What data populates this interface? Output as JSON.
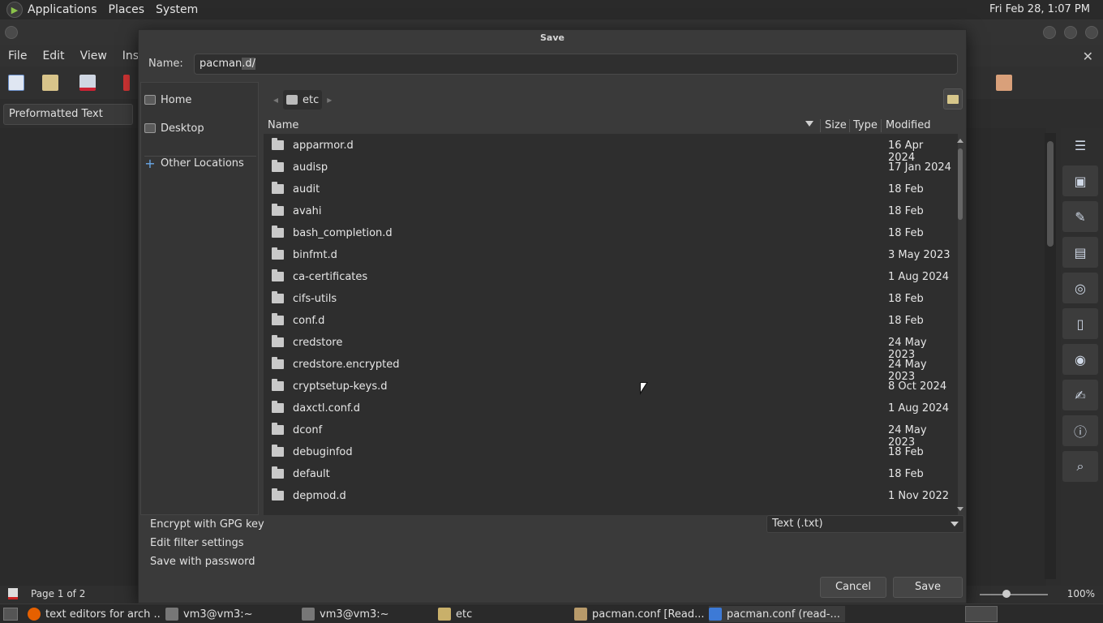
{
  "top_panel": {
    "menus": [
      "Applications",
      "Places",
      "System"
    ],
    "clock": "Fri Feb 28,  1:07 PM"
  },
  "background_app": {
    "menubar": [
      "File",
      "Edit",
      "View",
      "Inse"
    ],
    "paragraph_style": "Preformatted Text",
    "status_page": "Page 1 of 2",
    "zoom_level": 100,
    "zoom_text": "100%"
  },
  "dialog": {
    "title": "Save",
    "name_label": "Name:",
    "name_value_prefix": "pacman",
    "name_value_selected": ".d/",
    "places": [
      {
        "label": "Home",
        "icon": "home-icon"
      },
      {
        "label": "Desktop",
        "icon": "desktop-icon"
      },
      {
        "label": "Other Locations",
        "icon": "plus-icon"
      }
    ],
    "path": [
      "etc"
    ],
    "columns": [
      "Name",
      "Size",
      "Type",
      "Modified"
    ],
    "files": [
      {
        "name": "apparmor.d",
        "modified": "16 Apr 2024"
      },
      {
        "name": "audisp",
        "modified": "17 Jan 2024"
      },
      {
        "name": "audit",
        "modified": "18 Feb"
      },
      {
        "name": "avahi",
        "modified": "18 Feb"
      },
      {
        "name": "bash_completion.d",
        "modified": "18 Feb"
      },
      {
        "name": "binfmt.d",
        "modified": "3 May 2023"
      },
      {
        "name": "ca-certificates",
        "modified": "1 Aug 2024"
      },
      {
        "name": "cifs-utils",
        "modified": "18 Feb"
      },
      {
        "name": "conf.d",
        "modified": "18 Feb"
      },
      {
        "name": "credstore",
        "modified": "24 May 2023"
      },
      {
        "name": "credstore.encrypted",
        "modified": "24 May 2023"
      },
      {
        "name": "cryptsetup-keys.d",
        "modified": "8 Oct 2024"
      },
      {
        "name": "daxctl.conf.d",
        "modified": "1 Aug 2024"
      },
      {
        "name": "dconf",
        "modified": "24 May 2023"
      },
      {
        "name": "debuginfod",
        "modified": "18 Feb"
      },
      {
        "name": "default",
        "modified": "18 Feb"
      },
      {
        "name": "depmod.d",
        "modified": "1 Nov 2022"
      }
    ],
    "options": [
      "Encrypt with GPG key",
      "Edit filter settings",
      "Save with password"
    ],
    "filter": "Text (.txt)",
    "cancel_label": "Cancel",
    "save_label": "Save"
  },
  "taskbar": {
    "tasks": [
      {
        "label": "text editors for arch ...",
        "icon": "firefox-icon"
      },
      {
        "label": "vm3@vm3:~",
        "icon": "terminal-icon"
      },
      {
        "label": "vm3@vm3:~",
        "icon": "terminal-icon"
      },
      {
        "label": "etc",
        "icon": "folder-icon"
      },
      {
        "label": "pacman.conf [Read...",
        "icon": "text-editor-icon"
      },
      {
        "label": "pacman.conf (read-...",
        "icon": "writer-icon"
      }
    ]
  },
  "colors": {
    "accent": "#6aa9e9",
    "folder": "#c9c9c9",
    "dialog_bg": "#3a3a3a"
  }
}
